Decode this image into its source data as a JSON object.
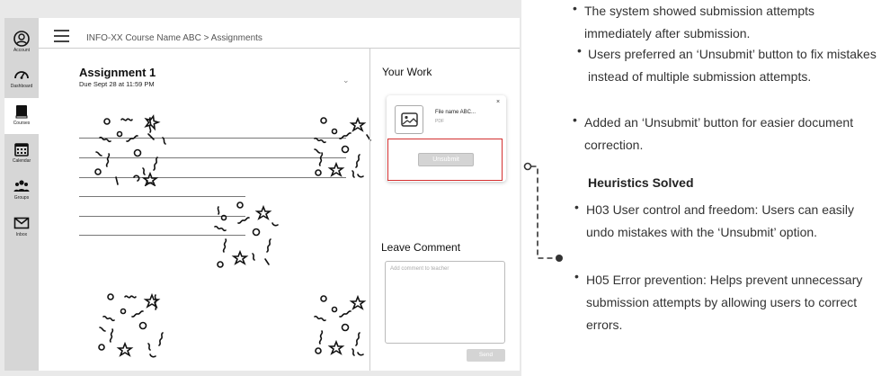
{
  "sidebar": {
    "items": [
      {
        "label": "Account",
        "icon": "account-icon"
      },
      {
        "label": "Dashboard",
        "icon": "dashboard-icon"
      },
      {
        "label": "Courses",
        "icon": "courses-icon",
        "active": true
      },
      {
        "label": "Calendar",
        "icon": "calendar-icon"
      },
      {
        "label": "Groups",
        "icon": "groups-icon"
      },
      {
        "label": "Inbox",
        "icon": "inbox-icon"
      }
    ]
  },
  "header": {
    "breadcrumb": "INFO-XX Course Name ABC > Assignments"
  },
  "assignment": {
    "title": "Assignment 1",
    "due": "Due Sept 28 at 11:59 PM"
  },
  "your_work": {
    "title": "Your Work",
    "file_name": "File name ABC...",
    "file_type": "PDF",
    "close_label": "×",
    "unsubmit_label": "Unsubmit"
  },
  "leave_comment": {
    "title": "Leave Comment",
    "placeholder": "Add comment to teacher",
    "send_label": "Send"
  },
  "notes": {
    "bullets_top": [
      "The system showed submission attempts immediately after submission.",
      "Users preferred an ‘Unsubmit’ button to fix mistakes instead of multiple submission attempts.",
      "Added an ‘Unsubmit’ button for easier document correction."
    ],
    "heuristics_title": "Heuristics Solved",
    "heuristics": [
      "H03 User control and freedom: Users can easily undo mistakes with the ‘Unsubmit’ option.",
      "H05 Error prevention: Helps prevent unnecessary submission attempts by allowing users to correct errors."
    ]
  },
  "colors": {
    "highlight": "#d32f2f",
    "sidebar": "#d6d6d6",
    "frame": "#e9e9e9"
  }
}
